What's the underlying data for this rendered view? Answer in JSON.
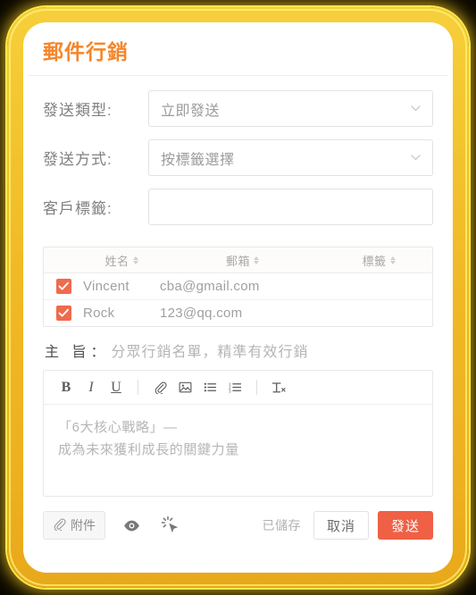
{
  "theme": {
    "frame_color": "#f0b824",
    "frame_highlight": "#ffe94a",
    "title_color": "#f5862a",
    "accent_color": "#ef6045",
    "checkbox_color": "#ef6a4e"
  },
  "header": {
    "title": "郵件行銷"
  },
  "form": {
    "rows": [
      {
        "label": "發送類型:",
        "value": "立即發送",
        "type": "select",
        "icon": "chevron-down-icon"
      },
      {
        "label": "發送方式:",
        "value": "按標籤選擇",
        "type": "select",
        "icon": "chevron-down-icon"
      },
      {
        "label": "客戶標籤:",
        "value": "",
        "type": "input",
        "placeholder": ""
      }
    ]
  },
  "table": {
    "columns": [
      {
        "key": "check",
        "label": "",
        "sortable": false
      },
      {
        "key": "name",
        "label": "姓名",
        "sortable": true
      },
      {
        "key": "email",
        "label": "郵箱",
        "sortable": true
      },
      {
        "key": "tag",
        "label": "標籤",
        "sortable": true
      }
    ],
    "rows": [
      {
        "checked": true,
        "name": "Vincent",
        "email": "cba@gmail.com",
        "tag": ""
      },
      {
        "checked": true,
        "name": "Rock",
        "email": "123@qq.com",
        "tag": ""
      }
    ]
  },
  "subject": {
    "label": "主 旨：",
    "value": "分眾行銷名單，精準有效行銷"
  },
  "editor": {
    "toolbar": [
      {
        "name": "bold-icon",
        "glyph": "B"
      },
      {
        "name": "italic-icon",
        "glyph": "I"
      },
      {
        "name": "underline-icon",
        "glyph": "U"
      },
      {
        "name": "toolbar-separator-1",
        "glyph": ""
      },
      {
        "name": "attachment-icon",
        "glyph": ""
      },
      {
        "name": "image-icon",
        "glyph": ""
      },
      {
        "name": "bullet-list-icon",
        "glyph": ""
      },
      {
        "name": "numbered-list-icon",
        "glyph": ""
      },
      {
        "name": "toolbar-separator-2",
        "glyph": ""
      },
      {
        "name": "clear-format-icon",
        "glyph": "T"
      }
    ],
    "body_line_1": "「6大核心戰略」—",
    "body_line_2": "成為未來獲利成長的關鍵力量"
  },
  "footer": {
    "attach_label": "附件",
    "attach_icon": "paperclip-icon",
    "preview_icon": "eye-icon",
    "magic_icon": "cursor-sparkle-icon",
    "saved_label": "已儲存",
    "cancel_label": "取消",
    "send_label": "發送"
  }
}
